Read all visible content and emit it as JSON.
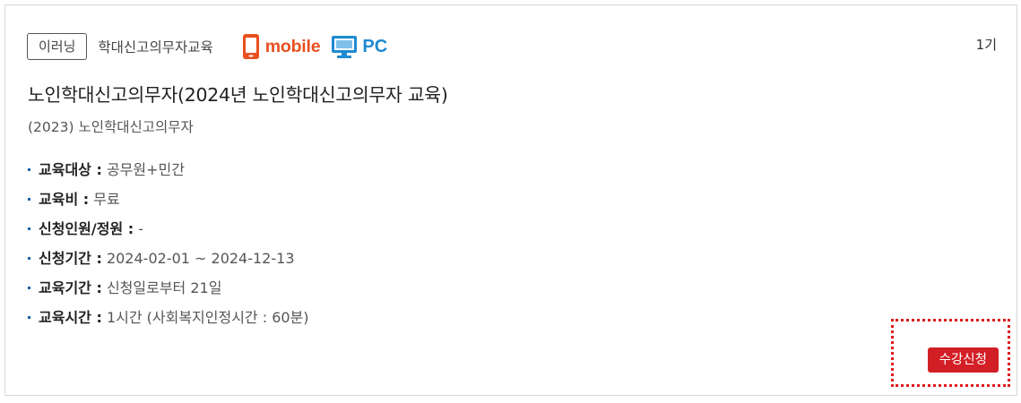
{
  "course": {
    "type_badge": "이러닝",
    "category": "학대신고의무자교육",
    "devices": {
      "mobile_label": "mobile",
      "pc_label": "PC",
      "mobile_color": "#e8501e",
      "pc_color": "#1f8ad0"
    },
    "round": "1기",
    "title": "노인학대신고의무자(2024년 노인학대신고의무자 교육)",
    "subtitle": "(2023) 노인학대신고의무자",
    "info": [
      {
        "key": "교육대상 :",
        "value": " 공무원+민간"
      },
      {
        "key": "교육비 :",
        "value": " 무료"
      },
      {
        "key": "신청인원/정원 :",
        "value": " -"
      },
      {
        "key": "신청기간 :",
        "value": " 2024-02-01 ~ 2024-12-13"
      },
      {
        "key": "교육기간 :",
        "value": " 신청일로부터 21일"
      },
      {
        "key": "교육시간 :",
        "value": " 1시간 (사회복지인정시간 : 60분)"
      }
    ],
    "apply_label": "수강신청",
    "apply_color": "#d21f26"
  }
}
